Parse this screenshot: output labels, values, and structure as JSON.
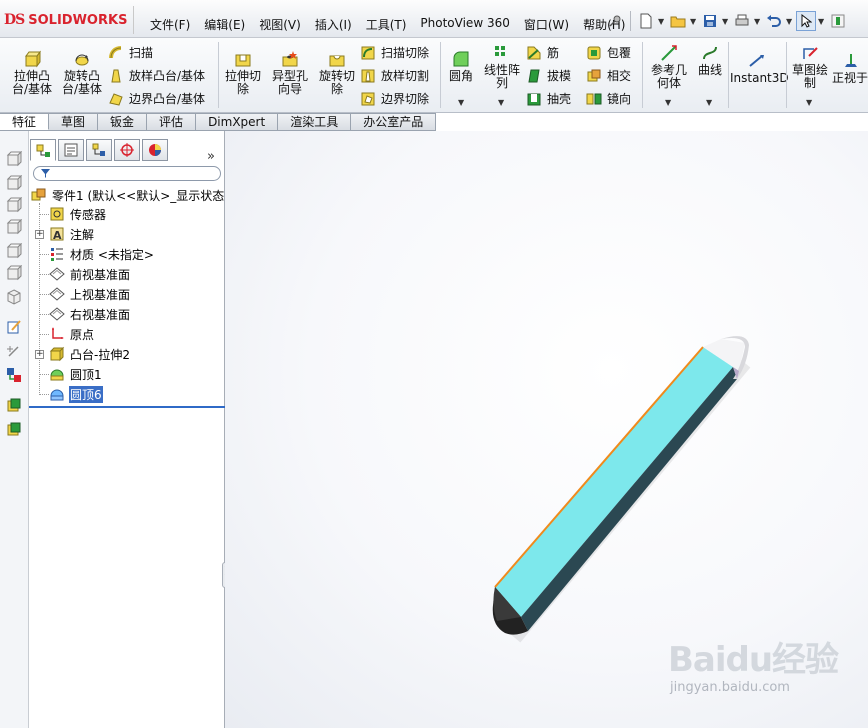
{
  "app": {
    "logo_ds": "DS",
    "logo_brand": "SOLIDWORKS"
  },
  "menu": {
    "items": [
      "文件(F)",
      "编辑(E)",
      "视图(V)",
      "插入(I)",
      "工具(T)",
      "PhotoView 360",
      "窗口(W)",
      "帮助(H)"
    ]
  },
  "ribbon": {
    "extrude_boss": "拉伸凸\n台/基体",
    "revolve_boss": "旋转凸\n台/基体",
    "sweep": "扫描",
    "loft_boss": "放样凸台/基体",
    "boundary_boss": "边界凸台/基体",
    "extrude_cut": "拉伸切\n除",
    "hole_wizard": "异型孔\n向导",
    "revolve_cut": "旋转切\n除",
    "sweep_cut": "扫描切除",
    "loft_cut": "放样切割",
    "boundary_cut": "边界切除",
    "fillet": "圆角",
    "linear_pattern": "线性阵\n列",
    "rib": "筋",
    "wrap": "包覆",
    "draft": "拔模",
    "intersect": "相交",
    "shell": "抽壳",
    "mirror": "镜向",
    "ref_geometry": "参考几\n何体",
    "curves": "曲线",
    "instant3d": "Instant3D",
    "sketch": "草图绘\n制",
    "normal_to": "正视于"
  },
  "tabs": [
    "特征",
    "草图",
    "钣金",
    "评估",
    "DimXpert",
    "渲染工具",
    "办公室产品"
  ],
  "active_tab": "特征",
  "feature_tree": {
    "root": "零件1  (默认<<默认>_显示状态",
    "items": [
      "传感器",
      "注解",
      "材质 <未指定>",
      "前视基准面",
      "上视基准面",
      "右视基准面",
      "原点",
      "凸台-拉伸2",
      "圆顶1",
      "圆顶6"
    ],
    "selected": "圆顶6"
  },
  "colors": {
    "accent": "#3a6ec6",
    "pencil_body": "#7de8ec",
    "pencil_side": "#2b4852",
    "pencil_edge": "#f08a1c",
    "logo_red": "#d9232e"
  },
  "watermark": {
    "brand": "Baidu经验",
    "url": "jingyan.baidu.com"
  }
}
